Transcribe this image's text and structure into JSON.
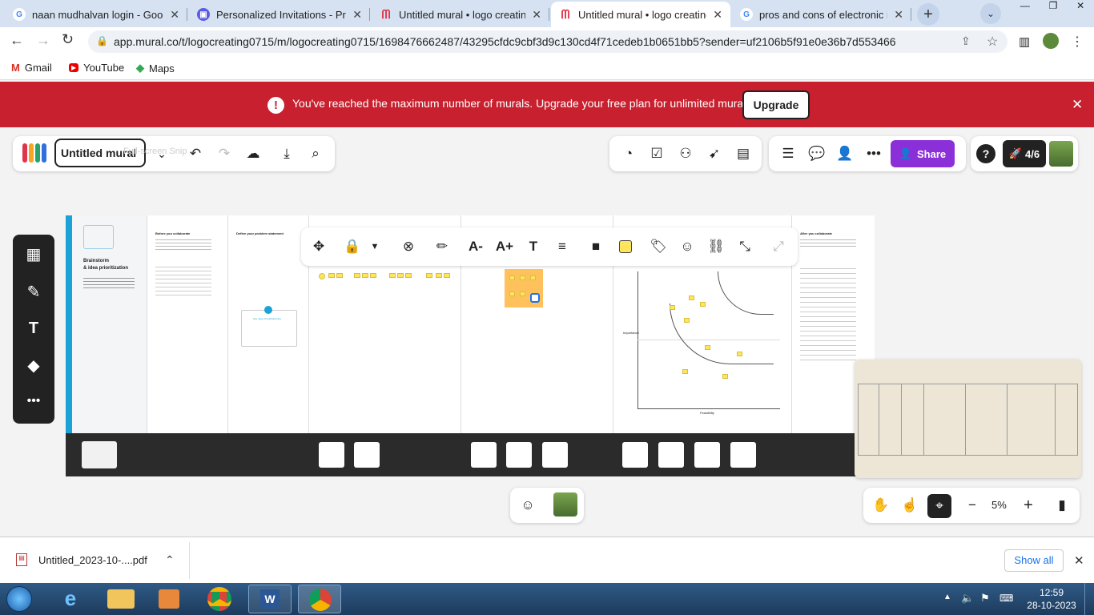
{
  "browser": {
    "tabs": [
      {
        "title": "naan mudhalvan login - Google",
        "icon": "google-icon",
        "active": false
      },
      {
        "title": "Personalized Invitations - Prese",
        "icon": "presentation-icon",
        "active": false
      },
      {
        "title": "Untitled mural • logo creating",
        "icon": "mural-icon",
        "active": false
      },
      {
        "title": "Untitled mural • logo creating",
        "icon": "mural-icon",
        "active": true
      },
      {
        "title": "pros and cons of electronic inv",
        "icon": "google-icon",
        "active": false
      }
    ],
    "url": "app.mural.co/t/logocreating0715/m/logocreating0715/1698476662487/43295cfdc9cbf3d9c130cd4f71cedeb1b0651bb5?sender=uf2106b5f91e0e36b7d553466",
    "bookmarks": [
      {
        "label": "Gmail",
        "icon": "gmail-icon"
      },
      {
        "label": "YouTube",
        "icon": "youtube-icon"
      },
      {
        "label": "Maps",
        "icon": "maps-icon"
      }
    ]
  },
  "banner": {
    "message": "You've reached the maximum number of murals. Upgrade your free plan for unlimited murals.",
    "upgrade_label": "Upgrade",
    "color": "#c8202f"
  },
  "toolbar": {
    "mural_title": "Untitled mural",
    "ghost_text": "Full-screen Snip",
    "share_label": "Share",
    "share_color": "#8b2fd8",
    "counter_label": "4/6"
  },
  "mural": {
    "intro_heading_line1": "Brainstorm",
    "intro_heading_line2": "& idea prioritization",
    "col2_heading": "Before you collaborate",
    "col3_heading": "Define your problem statement",
    "col3_card_title": "Key rules of brainstorming",
    "col7_heading": "After you collaborate",
    "axis_y": "Importance",
    "axis_x": "Feasibility"
  },
  "bottom_controls": {
    "zoom": "5%"
  },
  "downloads": {
    "file_name": "Untitled_2023-10-....pdf",
    "show_all": "Show all"
  },
  "taskbar": {
    "time": "12:59",
    "date": "28-10-2023"
  }
}
